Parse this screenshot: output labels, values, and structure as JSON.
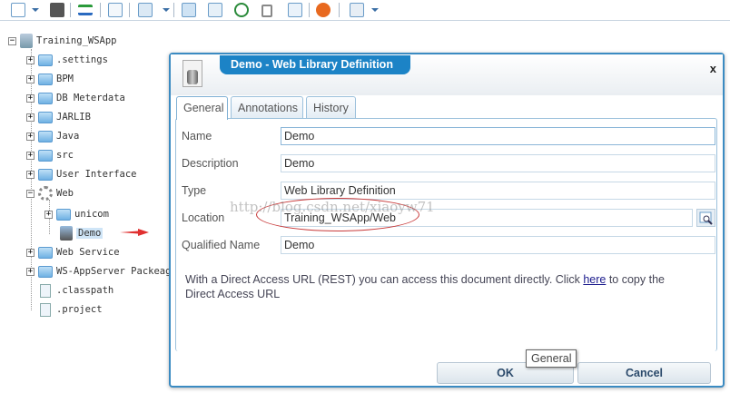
{
  "toolbar": {
    "icons": [
      "new-document-icon",
      "save-all-icon",
      "sync-icon",
      "document-icon",
      "copy-icon",
      "import-icon",
      "export-icon",
      "history-icon",
      "lock-icon",
      "revert-icon",
      "stop-icon",
      "edit-icon"
    ]
  },
  "tree": {
    "root": "Training_WSApp",
    "items": [
      ".settings",
      "BPM",
      "DB Meterdata",
      "JARLIB",
      "Java",
      "src",
      "User Interface",
      "Web",
      "Web Service",
      "WS-AppServer Packeage",
      ".classpath",
      ".project"
    ],
    "web_children": [
      "unicom",
      "Demo"
    ]
  },
  "dialog": {
    "title": "Demo - Web Library Definition",
    "close": "x",
    "tabs": [
      "General",
      "Annotations",
      "History"
    ],
    "fields": [
      {
        "label": "Name",
        "value": "Demo"
      },
      {
        "label": "Description",
        "value": "Demo"
      },
      {
        "label": "Type",
        "value": "Web Library Definition"
      },
      {
        "label": "Location",
        "value": "Training_WSApp/Web"
      },
      {
        "label": "Qualified Name",
        "value": "Demo"
      }
    ],
    "note_before": "With a Direct Access URL (REST) you can access this document directly. Click ",
    "note_link": "here",
    "note_after": " to copy the Direct Access URL",
    "ok": "OK",
    "cancel": "Cancel",
    "tooltip": "General"
  },
  "watermark": "http://blog.csdn.net/xiaoyw71",
  "colors": {
    "accent": "#1c83c6",
    "annotation": "#c83a3a"
  }
}
